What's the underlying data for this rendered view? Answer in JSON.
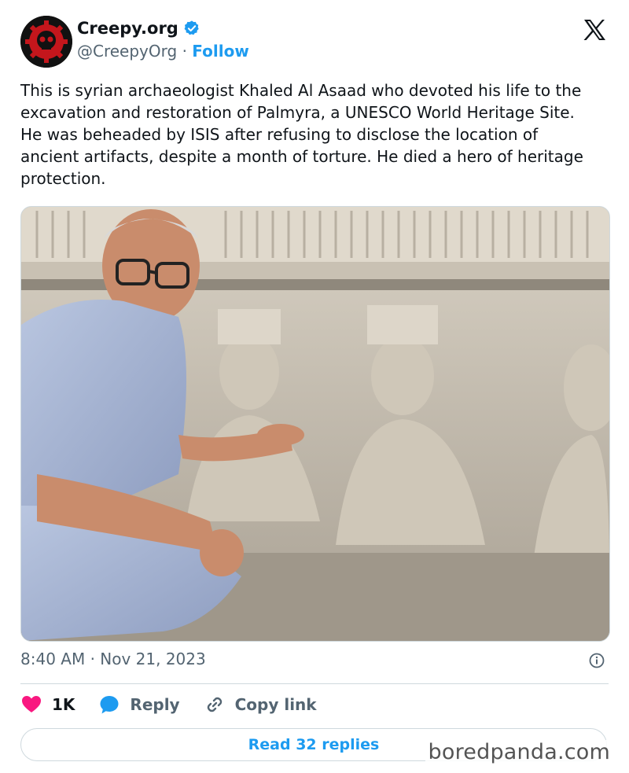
{
  "author": {
    "name": "Creepy.org",
    "handle": "@CreepyOrg",
    "separator": "·",
    "follow_label": "Follow",
    "verified_icon": "verified-badge-icon",
    "avatar_icon": "skull-gear-avatar"
  },
  "platform_icon": "x-logo-icon",
  "tweet": {
    "text": "This is syrian archaeologist Khaled Al Asaad who devoted his life to the\nexcavation and restoration of Palmyra, a UNESCO World Heritage Site.\nHe was beheaded by ISIS after refusing to disclose the location of\nancient artifacts, despite a month of torture. He died a hero of heritage\nprotection.",
    "timestamp": "8:40 AM · Nov 21, 2023"
  },
  "actions": {
    "like_count": "1K",
    "reply_label": "Reply",
    "copy_link_label": "Copy link"
  },
  "read_replies_label": "Read 32 replies",
  "watermark": "boredpanda.com",
  "colors": {
    "accent": "#1d9bf0",
    "like": "#f91880",
    "text": "#0f1419",
    "secondary": "#536471"
  }
}
